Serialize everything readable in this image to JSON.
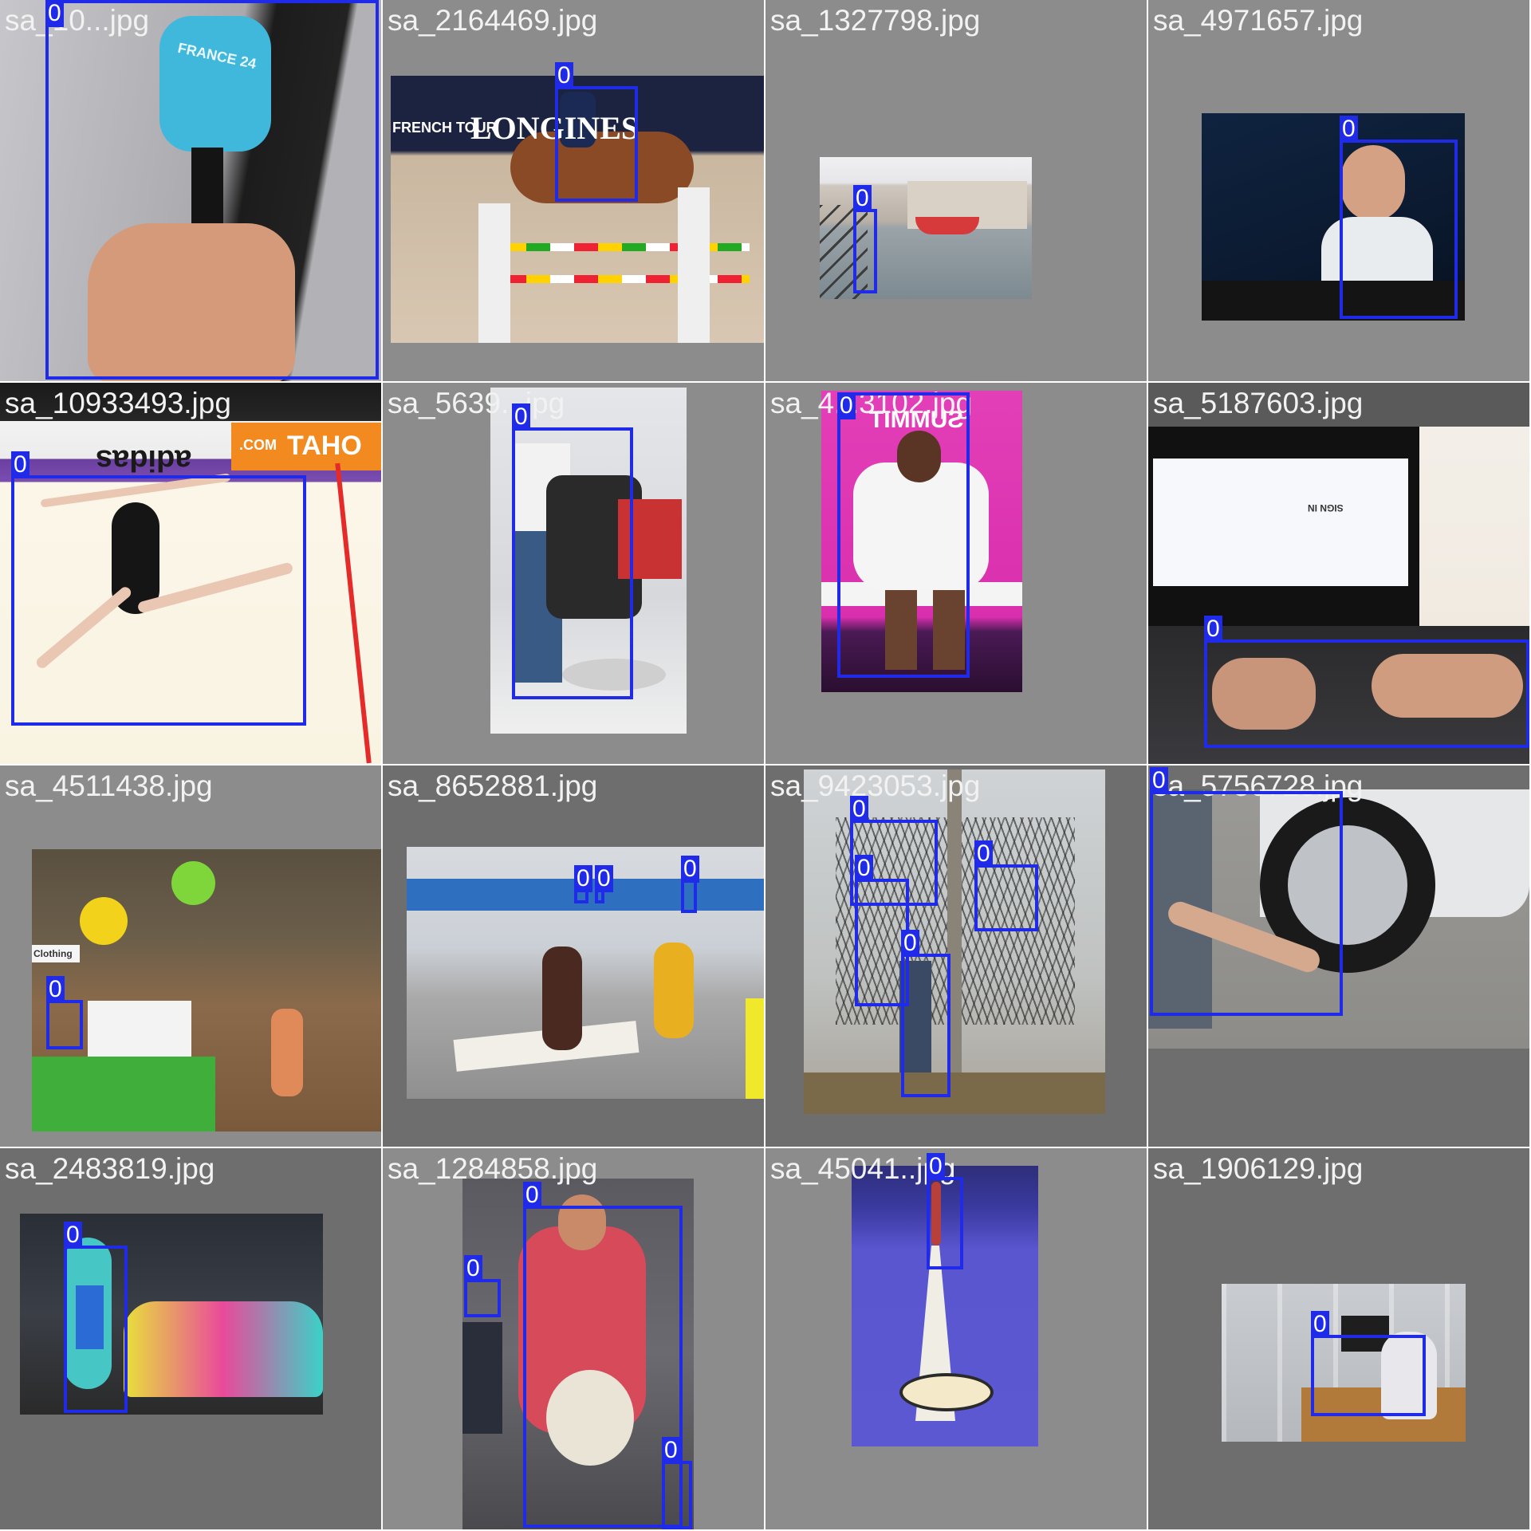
{
  "tiles": [
    {
      "file": "sa_10...jpg",
      "class_label": "0"
    },
    {
      "file": "sa_2164469.jpg",
      "class_label": "0"
    },
    {
      "file": "sa_1327798.jpg",
      "class_label": "0"
    },
    {
      "file": "sa_4971657.jpg",
      "class_label": "0"
    },
    {
      "file": "sa_10933493.jpg",
      "class_label": "0"
    },
    {
      "file": "sa_5639...jpg",
      "class_label": "0"
    },
    {
      "file": "sa_4...3102.jpg",
      "class_label": "0"
    },
    {
      "file": "sa_5187603.jpg",
      "class_label": "0"
    },
    {
      "file": "sa_4511438.jpg",
      "class_label": "0"
    },
    {
      "file": "sa_8652881.jpg",
      "class_label": "0"
    },
    {
      "file": "sa_9423053.jpg",
      "class_label": "0"
    },
    {
      "file": "sa_5756728.jpg",
      "class_label": "0"
    },
    {
      "file": "sa_2483819.jpg",
      "class_label": "0"
    },
    {
      "file": "sa_1284858.jpg",
      "class_label": "0"
    },
    {
      "file": "sa_45041..jpg",
      "class_label": "0"
    },
    {
      "file": "sa_1906129.jpg",
      "class_label": "0"
    }
  ],
  "photo_text": {
    "mic_brand": "FRANCE 24",
    "banner_longines": "LONGINES",
    "banner_french_tour": "FRENCH TOUR",
    "sponsor_adidas": "adidas",
    "sponsor_taho": "TAHO",
    "sponsor_com": ".COM",
    "summit_banner": "SUMMIT",
    "signin_text": "SIGN IN",
    "store_sign": "Clothing"
  },
  "colors": {
    "tile_bg_light": "#8c8c8c",
    "tile_bg_dark": "#6e6e6e",
    "bbox": "#1f2be8",
    "filename_text": "#f2f2f2"
  }
}
